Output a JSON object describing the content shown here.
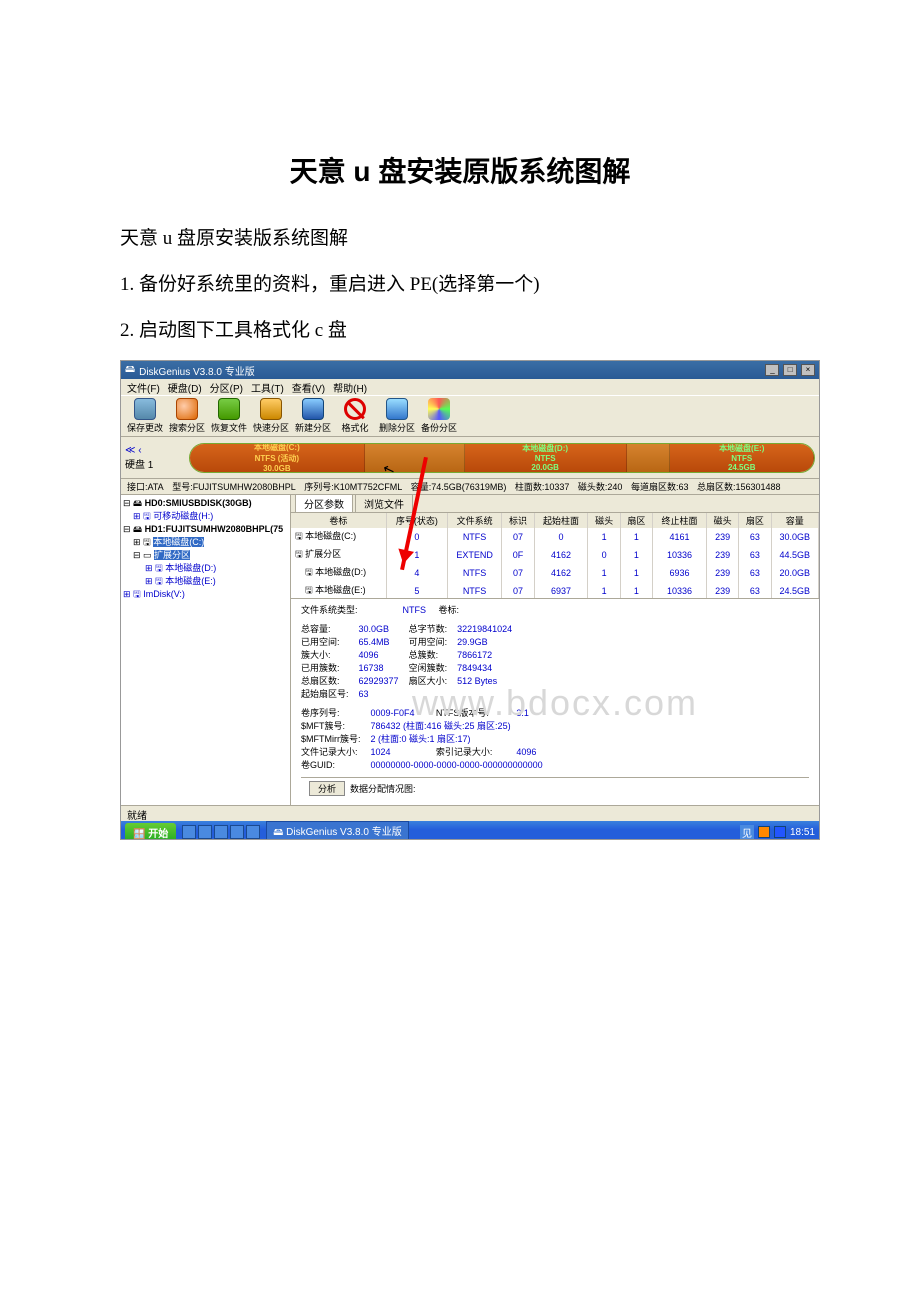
{
  "doc": {
    "title": "天意 u 盘安装原版系统图解",
    "subtitle": "天意 u 盘原安装版系统图解",
    "step1": "1. 备份好系统里的资料，重启进入 PE(选择第一个)",
    "step2": "2. 启动图下工具格式化 c 盘"
  },
  "app": {
    "title": "DiskGenius V3.8.0 专业版",
    "menu": [
      "文件(F)",
      "硬盘(D)",
      "分区(P)",
      "工具(T)",
      "查看(V)",
      "帮助(H)"
    ],
    "toolbar": [
      "保存更改",
      "搜索分区",
      "恢复文件",
      "快速分区",
      "新建分区",
      "格式化",
      "删除分区",
      "备份分区"
    ],
    "nav_label": "硬盘 1",
    "segs": {
      "c": {
        "name": "本地磁盘(C:)",
        "line2": "NTFS (活动)",
        "size": "30.0GB"
      },
      "d": {
        "name": "本地磁盘(D:)",
        "line2": "NTFS",
        "size": "20.0GB"
      },
      "e": {
        "name": "本地磁盘(E:)",
        "line2": "NTFS",
        "size": "24.5GB"
      }
    },
    "infoline": {
      "iface": "接口:ATA",
      "model": "型号:FUJITSUMHW2080BHPL",
      "serial": "序列号:K10MT752CFML",
      "capacity": "容量:74.5GB(76319MB)",
      "cyl": "柱面数:10337",
      "heads": "磁头数:240",
      "spt": "每道扇区数:63",
      "total": "总扇区数:156301488"
    },
    "tree": {
      "hd0": "HD0:SMIUSBDISK(30GB)",
      "hd0_rem": "可移动磁盘(H:)",
      "hd1": "HD1:FUJITSUMHW2080BHPL(75",
      "c": "本地磁盘(C:)",
      "ext": "扩展分区",
      "d": "本地磁盘(D:)",
      "e": "本地磁盘(E:)",
      "img": "ImDisk(V:)"
    },
    "tabs": {
      "params": "分区参数",
      "browse": "浏览文件"
    },
    "cols": [
      "卷标",
      "序号(状态)",
      "文件系统",
      "标识",
      "起始柱面",
      "磁头",
      "扇区",
      "终止柱面",
      "磁头",
      "扇区",
      "容量"
    ],
    "rows": [
      {
        "name": "本地磁盘(C:)",
        "idx": "0",
        "fs": "NTFS",
        "flag": "07",
        "sc": "0",
        "sh": "1",
        "ss": "1",
        "ec": "4161",
        "eh": "239",
        "es": "63",
        "cap": "30.0GB"
      },
      {
        "name": "扩展分区",
        "idx": "1",
        "fs": "EXTEND",
        "flag": "0F",
        "sc": "4162",
        "sh": "0",
        "ss": "1",
        "ec": "10336",
        "eh": "239",
        "es": "63",
        "cap": "44.5GB"
      },
      {
        "name": "本地磁盘(D:)",
        "idx": "4",
        "fs": "NTFS",
        "flag": "07",
        "sc": "4162",
        "sh": "1",
        "ss": "1",
        "ec": "6936",
        "eh": "239",
        "es": "63",
        "cap": "20.0GB"
      },
      {
        "name": "本地磁盘(E:)",
        "idx": "5",
        "fs": "NTFS",
        "flag": "07",
        "sc": "6937",
        "sh": "1",
        "ss": "1",
        "ec": "10336",
        "eh": "239",
        "es": "63",
        "cap": "24.5GB"
      }
    ],
    "fs": {
      "fstype_label": "文件系统类型:",
      "fstype": "NTFS",
      "vol_label": "卷标:",
      "l_total": "总容量:",
      "v_total": "30.0GB",
      "l_bytes": "总字节数:",
      "v_bytes": "32219841024",
      "l_used": "已用空间:",
      "v_used": "65.4MB",
      "l_avail": "可用空间:",
      "v_avail": "29.9GB",
      "l_clus": "簇大小:",
      "v_clus": "4096",
      "l_tclus": "总簇数:",
      "v_tclus": "7866172",
      "l_uclus": "已用簇数:",
      "v_uclus": "16738",
      "l_fclus": "空闲簇数:",
      "v_fclus": "7849434",
      "l_tsec": "总扇区数:",
      "v_tsec": "62929377",
      "l_ssize": "扇区大小:",
      "v_ssize": "512 Bytes",
      "l_ssec": "起始扇区号:",
      "v_ssec": "63",
      "l_vsn": "卷序列号:",
      "v_vsn": "0009-F0F4",
      "l_ntfsv": "NTFS版本号:",
      "v_ntfsv": "3.1",
      "l_mft": "$MFT簇号:",
      "v_mft": "786432 (柱面:416 磁头:25 扇区:25)",
      "l_mftm": "$MFTMirr簇号:",
      "v_mftm": "2 (柱面:0 磁头:1 扇区:17)",
      "l_frs": "文件记录大小:",
      "v_frs": "1024",
      "l_irs": "索引记录大小:",
      "v_irs": "4096",
      "l_guid": "卷GUID:",
      "v_guid": "00000000-0000-0000-0000-000000000000",
      "analyse": "分析",
      "alloc": "数据分配情况图:"
    },
    "status": "就绪",
    "taskbar": {
      "start": "开始",
      "task": "DiskGenius V3.8.0 专业版",
      "time": "18:51"
    },
    "watermark": "www.bdocx.com"
  }
}
